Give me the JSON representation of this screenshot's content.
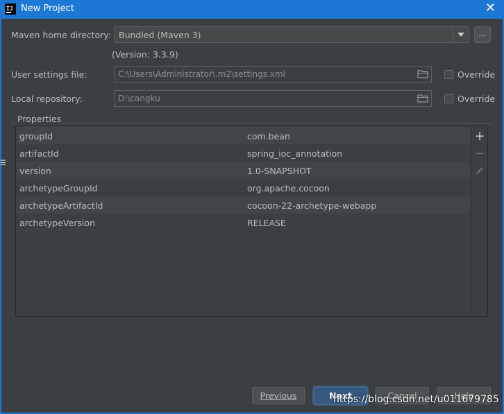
{
  "window": {
    "title": "New Project",
    "app_icon_text": "IJ"
  },
  "maven_home": {
    "label": "Maven home directory:",
    "value": "Bundled (Maven 3)",
    "browse_label": "...",
    "version": "(Version: 3.3.9)"
  },
  "user_settings": {
    "label": "User settings file:",
    "value": "C:\\Users\\Administrator\\.m2\\settings.xml",
    "override_label": "Override",
    "override_checked": false
  },
  "local_repo": {
    "label": "Local repository:",
    "value": "D:\\cangku",
    "override_label": "Override",
    "override_checked": false
  },
  "properties": {
    "legend": "Properties",
    "rows": [
      {
        "key": "groupId",
        "value": "com.bean"
      },
      {
        "key": "artifactId",
        "value": "spring_ioc_annotation"
      },
      {
        "key": "version",
        "value": "1.0-SNAPSHOT"
      },
      {
        "key": "archetypeGroupId",
        "value": "org.apache.cocoon"
      },
      {
        "key": "archetypeArtifactId",
        "value": "cocoon-22-archetype-webapp"
      },
      {
        "key": "archetypeVersion",
        "value": "RELEASE"
      }
    ],
    "toolbar": {
      "add_icon": "plus-icon",
      "remove_icon": "minus-icon",
      "edit_icon": "pencil-icon"
    }
  },
  "buttons": {
    "previous": "Previous",
    "next": "Next",
    "cancel": "Cancel",
    "help": "Help"
  },
  "watermark": "https://blog.csdn.net/u011679785",
  "colors": {
    "titlebar": "#1c78d4",
    "background": "#3c3f41",
    "primary_button": "#365880"
  }
}
